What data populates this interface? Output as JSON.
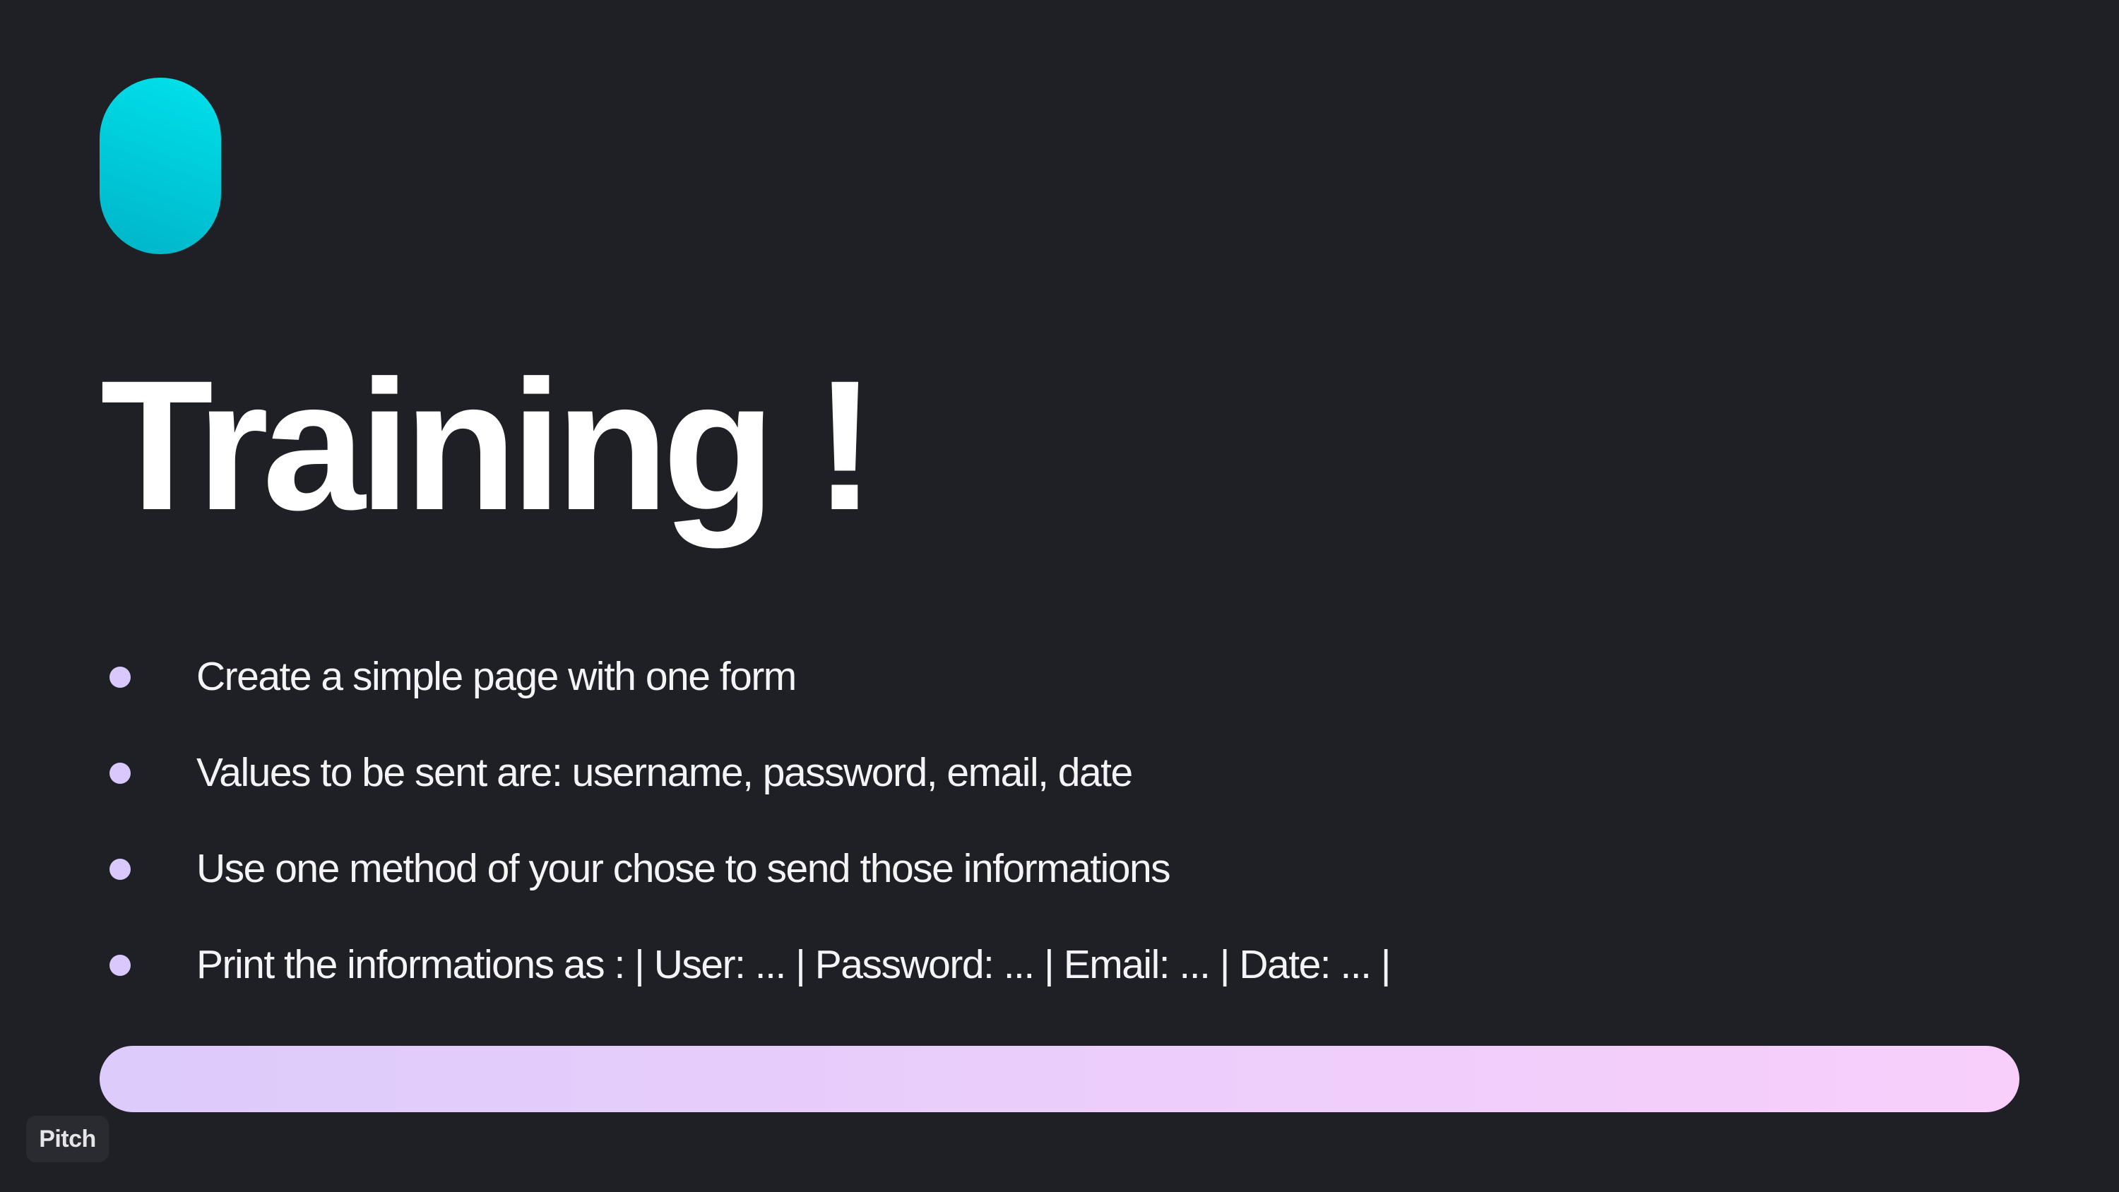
{
  "slide": {
    "title": "Training !",
    "accent_color": "#00d4e2",
    "bar_gradient": [
      "#dccbfb",
      "#f8cffb"
    ],
    "bullet_color": "#d9c8fb",
    "bullets": [
      "Create a simple page with one form",
      "Values to be sent are: username, password, email, date",
      "Use one method of your chose to send those informations",
      "Print the informations as : | User: ... | Password: ... | Email: ... | Date: ... |"
    ]
  },
  "badge": {
    "label": "Pitch"
  }
}
